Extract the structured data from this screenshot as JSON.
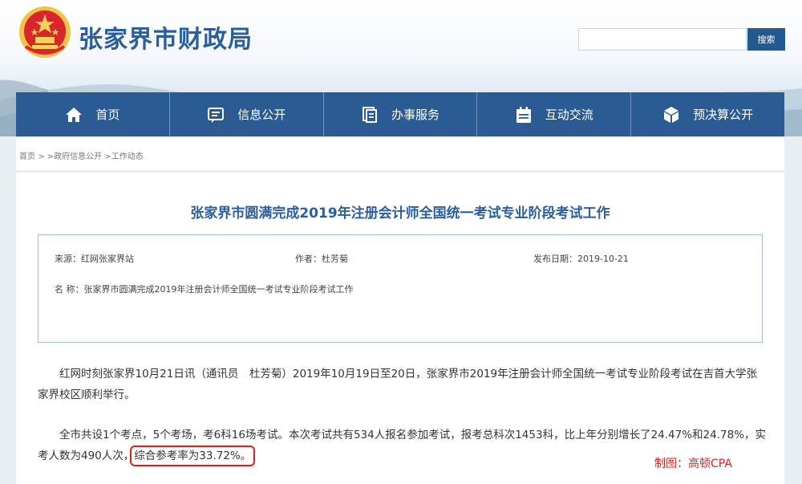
{
  "header": {
    "site_title": "张家界市财政局",
    "search_placeholder": "",
    "search_button": "搜索"
  },
  "nav": {
    "items": [
      {
        "label": "首页",
        "icon": "home-icon"
      },
      {
        "label": "信息公开",
        "icon": "info-icon"
      },
      {
        "label": "办事服务",
        "icon": "service-icon"
      },
      {
        "label": "互动交流",
        "icon": "interact-icon"
      },
      {
        "label": "预决算公开",
        "icon": "budget-icon"
      }
    ]
  },
  "breadcrumb": {
    "home": "首页",
    "sep1": ">",
    "level1": ">政府信息公开",
    "level2": ">工作动态"
  },
  "article": {
    "title": "张家界市圆满完成2019年注册会计师全国统一考试专业阶段考试工作",
    "source": "来源：红网张家界站",
    "author": "作者：杜芳菊",
    "date": "发布日期：2019-10-21",
    "name": "名 称：张家界市圆满完成2019年注册会计师全国统一考试专业阶段考试工作",
    "para1": "红网时刻张家界10月21日讯（通讯员　杜芳菊）2019年10月19日至20日，张家界市2019年注册会计师全国统一考试专业阶段考试在吉首大学张家界校区顺利举行。",
    "para2_a": "全市共设1个考点，5个考场，考6科16场考试。本次考试共有534人报名参加考试，报考总科次1453科，比上年分别增长了24.47%和24.78%，实考人数为490人次，",
    "para2_highlight": "综合参考率为33.72%。"
  },
  "watermark": "制图：高顿CPA",
  "colors": {
    "brand": "#2a5e9e",
    "nav_bg": "#2a5c93",
    "highlight": "#e02020"
  }
}
